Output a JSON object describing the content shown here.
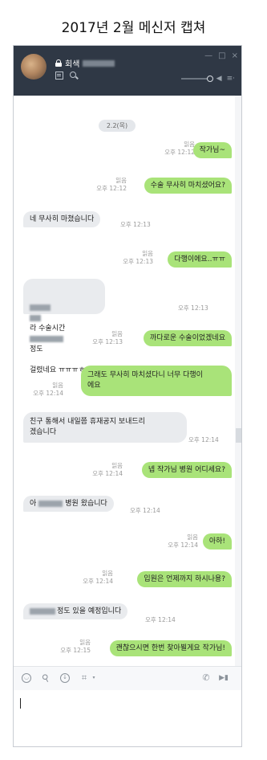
{
  "caption": "2017년 2월 메신저 캡쳐",
  "window": {
    "title_prefix": "회색",
    "controls": {
      "minimize": "—",
      "maximize": "□",
      "close": "×"
    },
    "sound_icon": "◀",
    "menu_icon": "≡·"
  },
  "chat": {
    "date": "2.2(목)",
    "read_label": "읽음",
    "messages": [
      {
        "side": "out",
        "text": "작가님~",
        "time": "오후 12:12"
      },
      {
        "side": "out",
        "text": "수술 무사히 마치셨어요?",
        "time": "오후 12:12"
      },
      {
        "side": "in",
        "text": "네 무사히 마쳤습니다",
        "time": "오후 12:13"
      },
      {
        "side": "out",
        "text": "다행이에요..ㅠㅠ",
        "time": "오후 12:13"
      },
      {
        "side": "in",
        "text_a": "라 수술시간",
        "text_b": "정도",
        "text_c": "걸렸네요 ㅠㅠㅠㅎㅎㅎ",
        "time": "오후 12:13"
      },
      {
        "side": "out",
        "text": "까다로운 수술이었겠네요",
        "time": "오후 12:13"
      },
      {
        "side": "out",
        "text": "그래도 무사히 마치셨다니 너무 다행이\n에요",
        "time": "오후 12:14"
      },
      {
        "side": "in",
        "text": "친구 통해서 내일쯤 휴재공지 보내드리\n겠습니다",
        "time": "오후 12:14"
      },
      {
        "side": "out",
        "text": "넵 작가님 병원 어디세요?",
        "time": "오후 12:14"
      },
      {
        "side": "in",
        "text_a": "아",
        "text_b": "병원 왔습니다",
        "time": "오후 12:14"
      },
      {
        "side": "out",
        "text": "아하!",
        "time": "오후 12:14"
      },
      {
        "side": "out",
        "text": "입원은 언제까지 하시나용?",
        "time": "오후 12:14"
      },
      {
        "side": "in",
        "text": "정도 있을 예정입니다",
        "time": "오후 12:14"
      },
      {
        "side": "out",
        "text": "괜찮으시면 한번 찾아뵐게요 작가님!",
        "time": "오후 12:15"
      }
    ]
  },
  "toolbar": {
    "emoji_icon": "◡",
    "clip_icon": "⚲",
    "download_icon": "↓",
    "crop_icon": "⌗",
    "caret_icon": "▾",
    "phone_icon": "✆",
    "video_icon": "▶▮"
  }
}
